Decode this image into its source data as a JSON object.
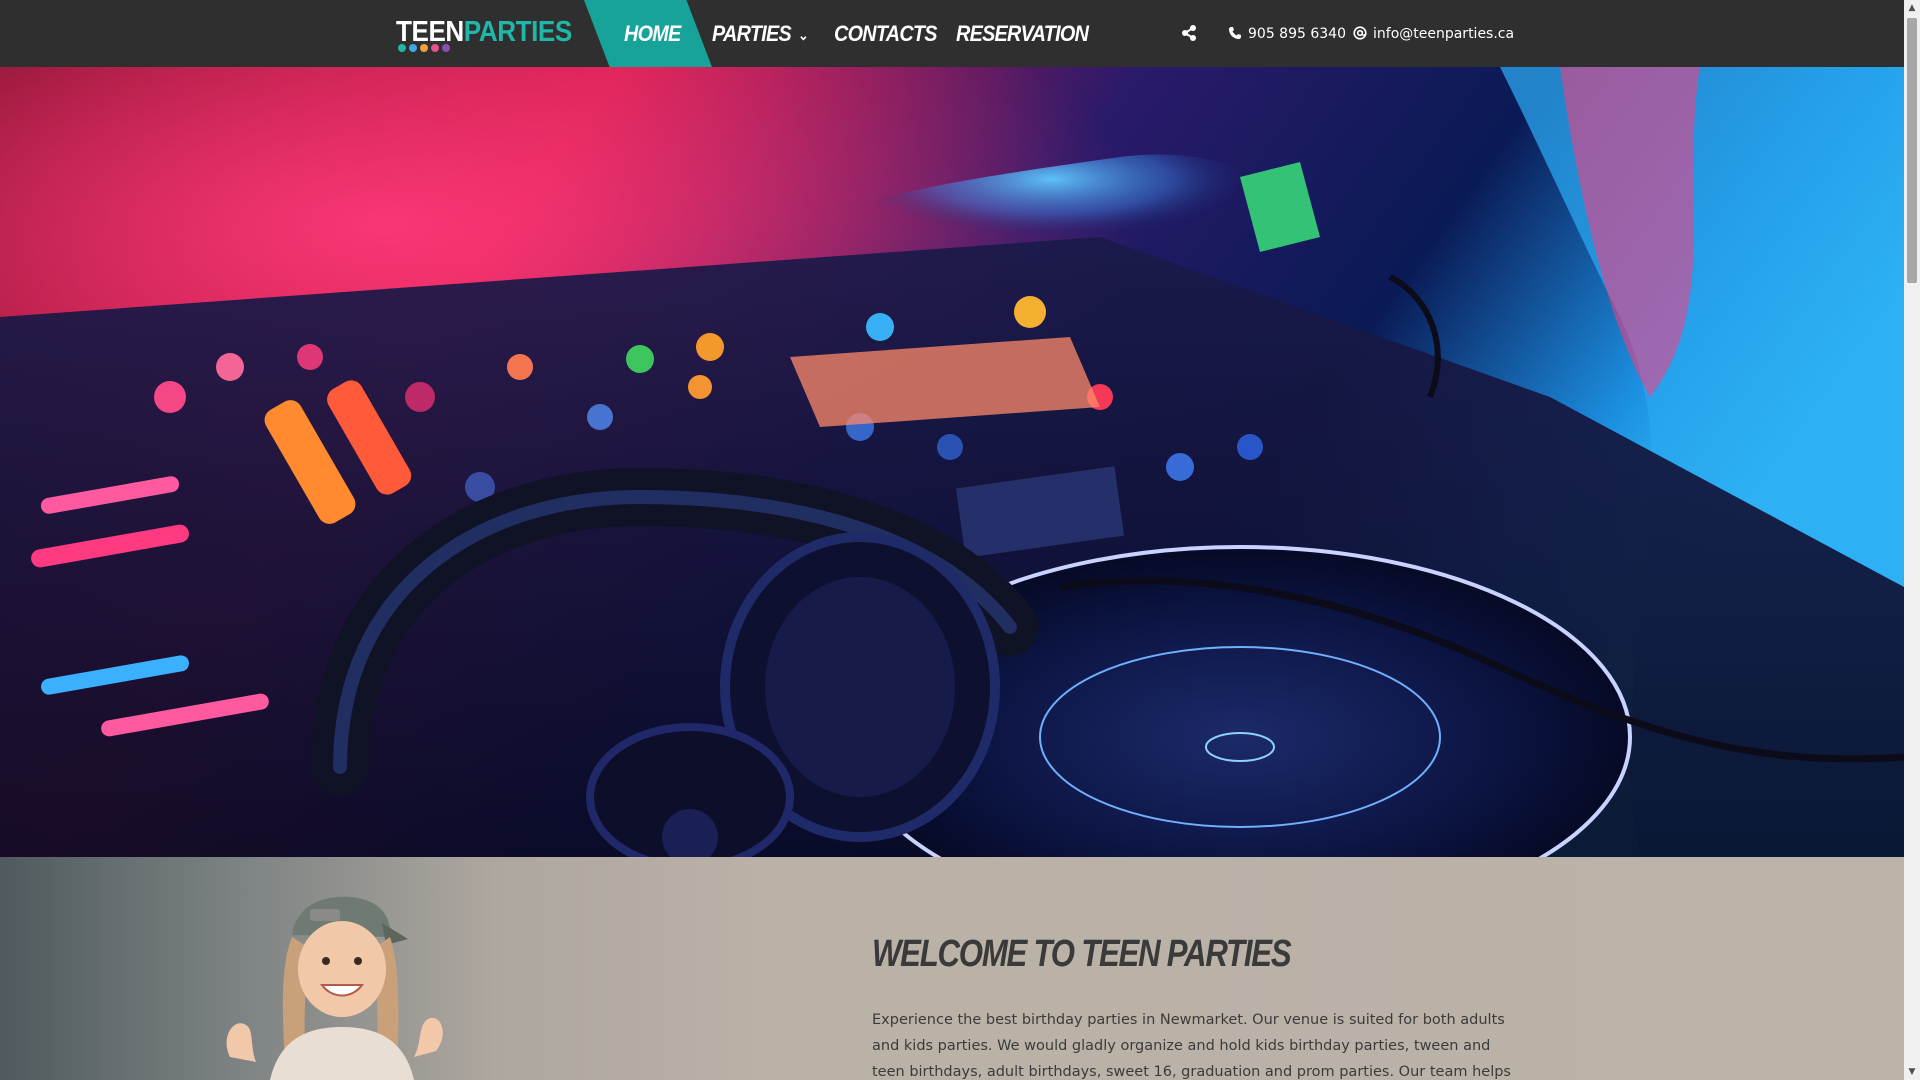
{
  "header": {
    "logo": {
      "text_teen": "TEEN",
      "text_parties": "PARTIES",
      "dot_colors": [
        "#1fb7a8",
        "#3da9e0",
        "#f0a23a",
        "#e8508a",
        "#8a4fb5"
      ]
    },
    "nav": [
      {
        "label": "HOME",
        "active": true
      },
      {
        "label": "PARTIES",
        "has_dropdown": true
      },
      {
        "label": "CONTACTS"
      },
      {
        "label": "RESERVATION"
      }
    ],
    "share_icon": "share-icon",
    "phone": "905 895 6340",
    "email": "info@teenparties.ca"
  },
  "hero": {
    "image": "dj-mixer-with-headphones-photo"
  },
  "welcome": {
    "title": "WELCOME TO TEEN PARTIES",
    "body": "Experience the best birthday parties in Newmarket. Our venue is suited  for both adults and kids parties. We would gladly organize and hold kids birthday parties, tween and teen birthdays, adult birthdays, sweet 16, graduation and prom parties.  Our team helps you",
    "photo": "girl-with-cap-photo"
  },
  "colors": {
    "nav_bg": "#2f2f2f",
    "accent": "#17a39a",
    "section_bg": "#bbb2a8"
  }
}
